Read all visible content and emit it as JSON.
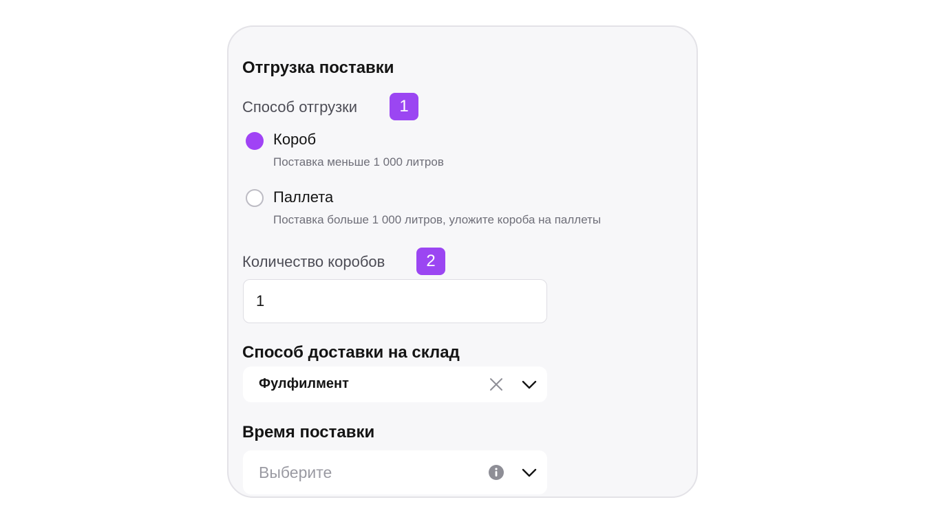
{
  "form": {
    "title": "Отгрузка поставки",
    "shipment_method": {
      "label": "Способ отгрузки",
      "badge": "1",
      "options": [
        {
          "label": "Короб",
          "hint": "Поставка меньше 1 000 литров",
          "selected": true
        },
        {
          "label": "Паллета",
          "hint": "Поставка больше 1 000 литров, уложите короба на паллеты",
          "selected": false
        }
      ]
    },
    "box_count": {
      "label": "Количество коробов",
      "badge": "2",
      "value": "1"
    },
    "delivery_method": {
      "label": "Способ доставки на склад",
      "value": "Фулфилмент",
      "icons": [
        "clear-icon",
        "chevron-down-icon"
      ]
    },
    "delivery_time": {
      "label": "Время поставки",
      "placeholder": "Выберите",
      "icons": [
        "info-icon",
        "chevron-down-icon"
      ]
    }
  },
  "colors": {
    "accent": "#9b46f2",
    "panel_background": "#f7f7f9",
    "panel_border": "#e3e2e7"
  }
}
